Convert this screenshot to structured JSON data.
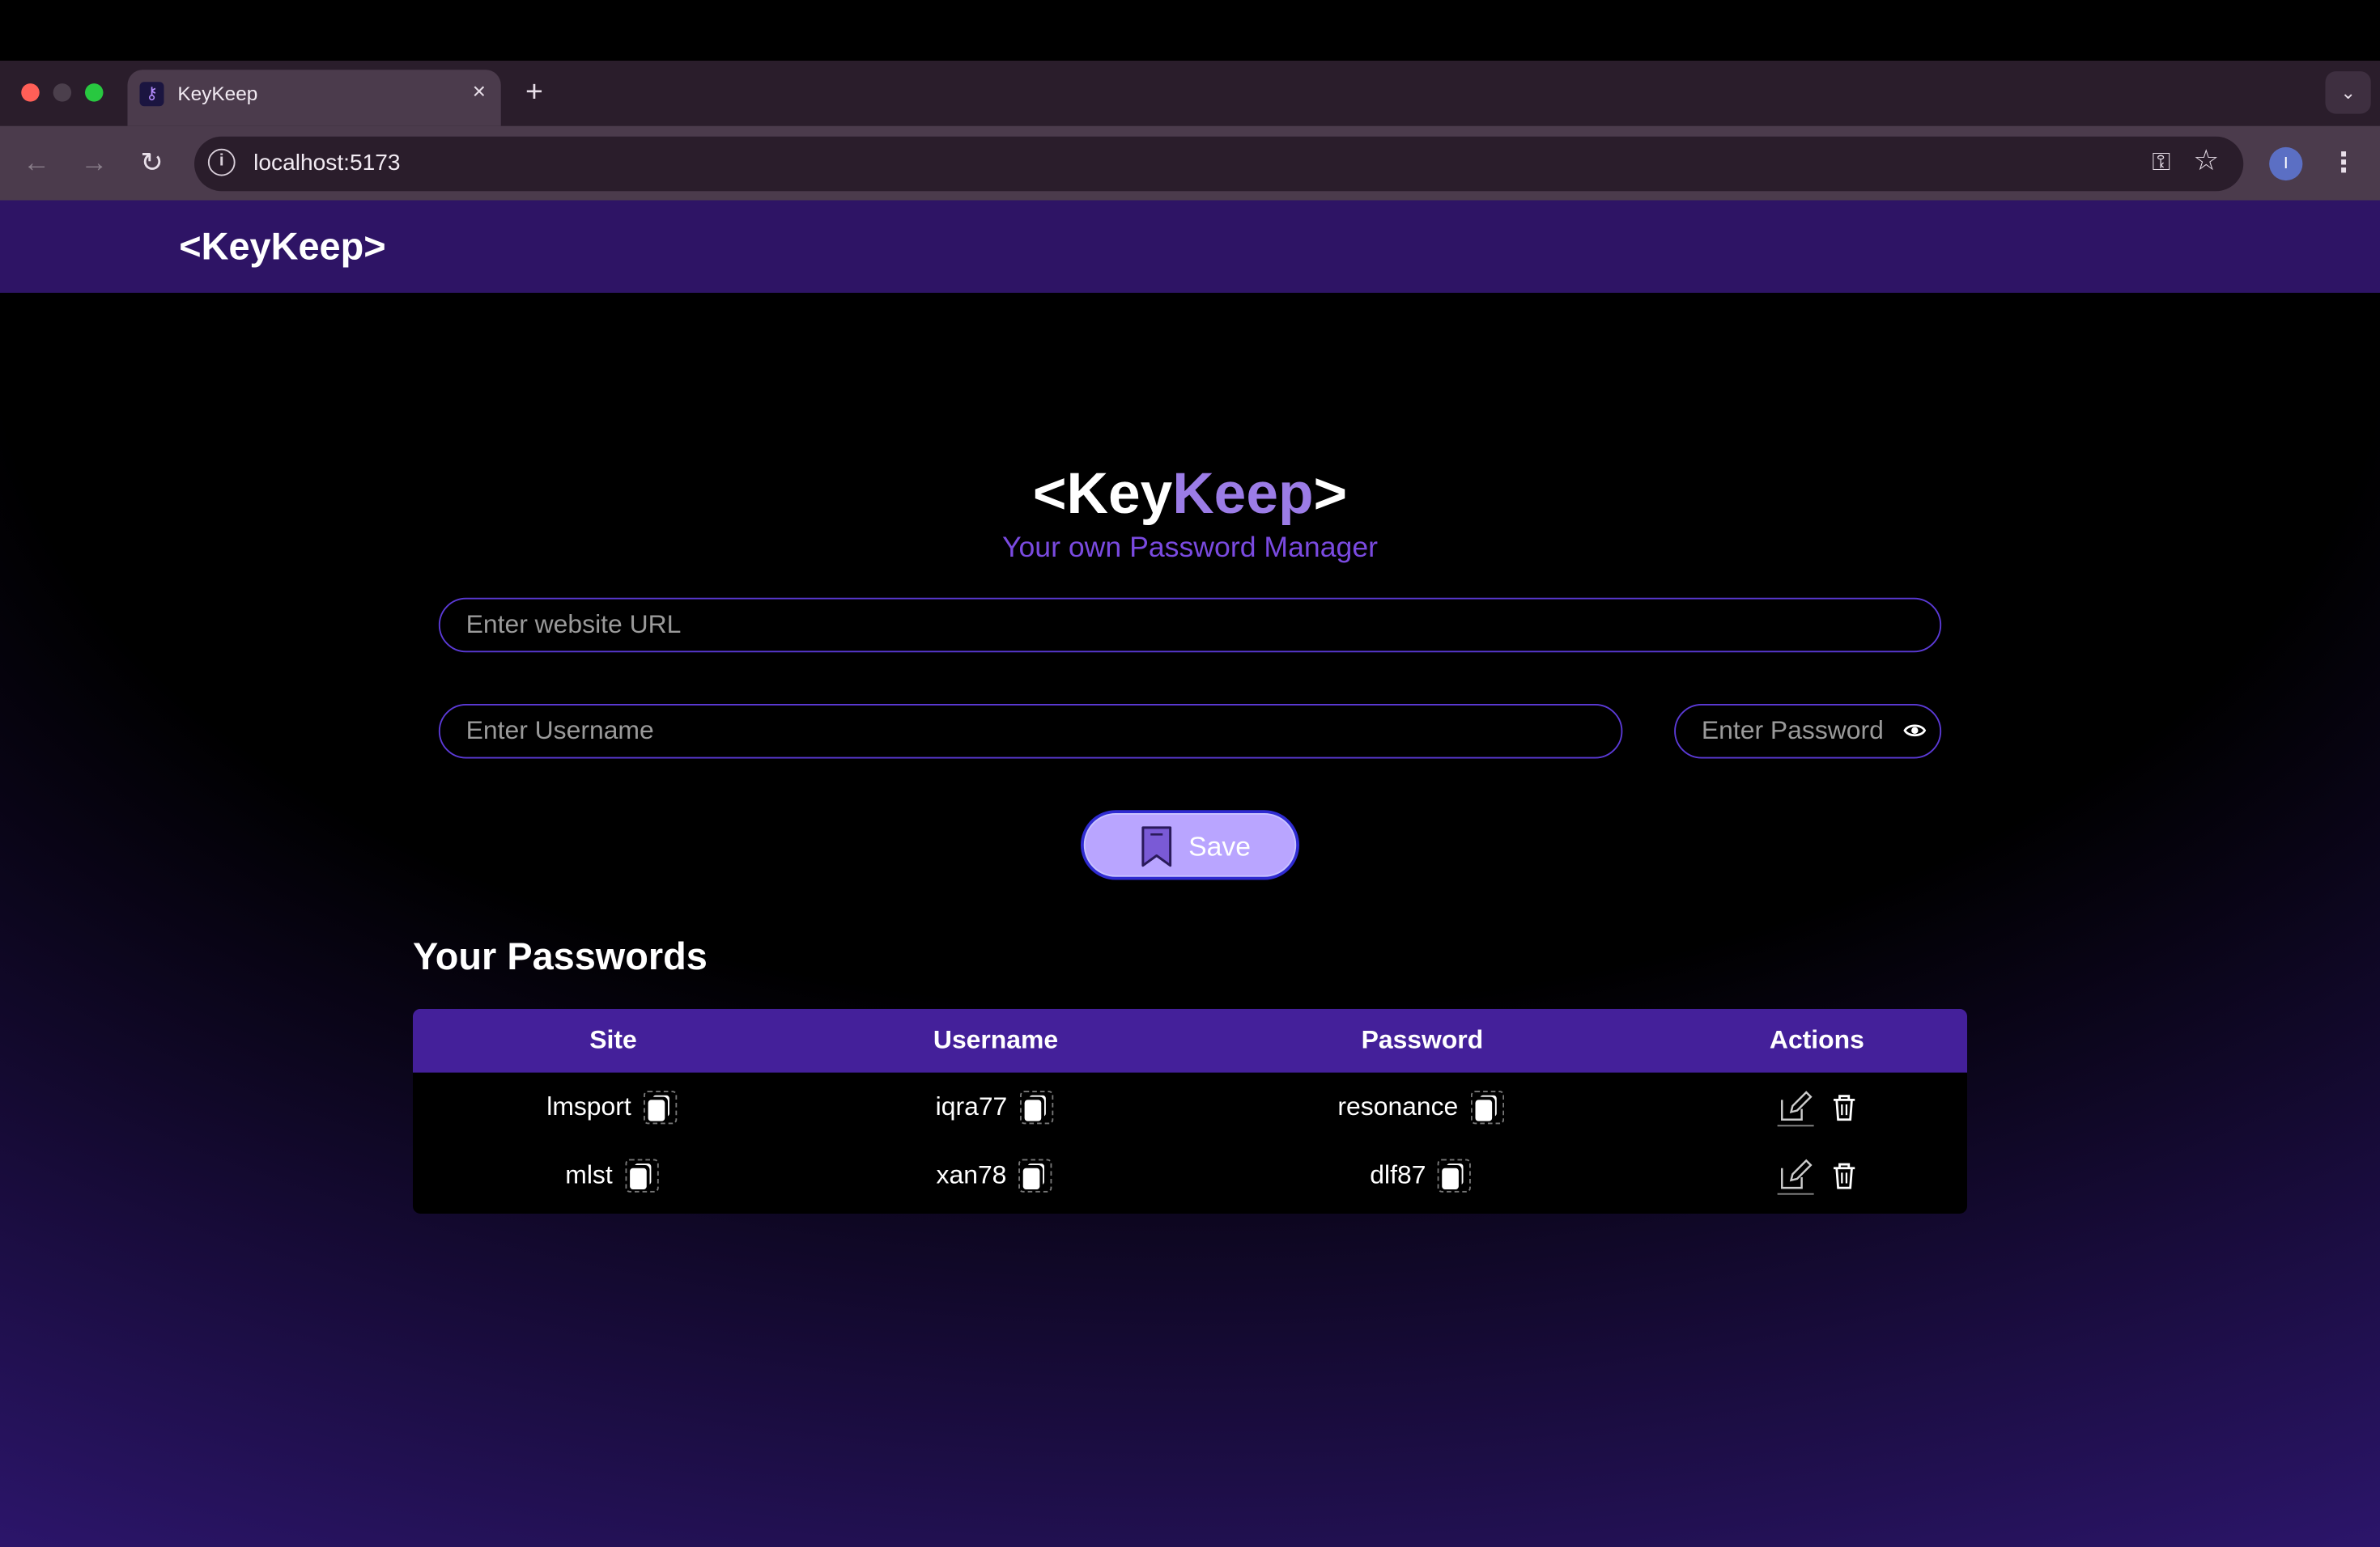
{
  "browser": {
    "tab_title": "KeyKeep",
    "tab_close": "×",
    "new_tab": "+",
    "tab_menu": "⌄",
    "url": "localhost:5173",
    "site_info": "i",
    "password_key_icon": "⚿",
    "bookmark_star": "☆",
    "profile_initial": "I",
    "menu": "⋮",
    "back": "←",
    "forward": "→",
    "reload": "↻"
  },
  "navbar": {
    "logo": "<KeyKeep>"
  },
  "hero": {
    "logo_open": "<Key",
    "logo_accent": "Keep",
    "logo_close": ">",
    "tagline": "Your own Password Manager"
  },
  "form": {
    "url_placeholder": "Enter website URL",
    "username_placeholder": "Enter Username",
    "password_placeholder": "Enter Password",
    "eye_icon": "👁",
    "save_label": "Save"
  },
  "passwords": {
    "title": "Your Passwords",
    "columns": [
      "Site",
      "Username",
      "Password",
      "Actions"
    ],
    "rows": [
      {
        "site": "lmsport",
        "username": "iqra77",
        "password": "resonance"
      },
      {
        "site": "mlst",
        "username": "xan78",
        "password": "dlf87"
      }
    ]
  },
  "colors": {
    "navbar_bg": "#2e1465",
    "accent": "#9b7ce6",
    "tagline": "#7a4ae0",
    "input_border": "#5b3ad6",
    "table_header": "#44209a",
    "save_bg": "#b9a5ff"
  }
}
